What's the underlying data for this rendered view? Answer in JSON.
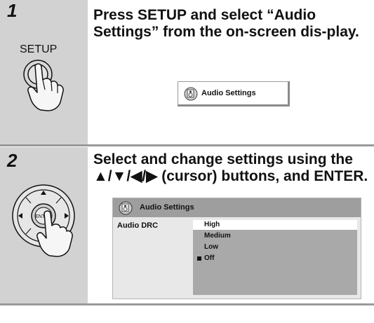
{
  "step1": {
    "number": "1",
    "button_label": "SETUP",
    "instruction": "Press SETUP and select “Audio Settings” from the on-screen dis-play.",
    "menu_item_label": "Audio Settings"
  },
  "step2": {
    "number": "2",
    "instruction": "Select and change settings using the ▲/▼/◀/▶ (cursor) buttons, and ENTER.",
    "enter_label": "ENTER",
    "osd": {
      "title": "Audio Settings",
      "setting_name": "Audio DRC",
      "options": [
        {
          "label": "High",
          "highlighted": true,
          "current": false
        },
        {
          "label": "Medium",
          "highlighted": false,
          "current": false
        },
        {
          "label": "Low",
          "highlighted": false,
          "current": false
        },
        {
          "label": "Off",
          "highlighted": false,
          "current": true
        }
      ]
    }
  }
}
